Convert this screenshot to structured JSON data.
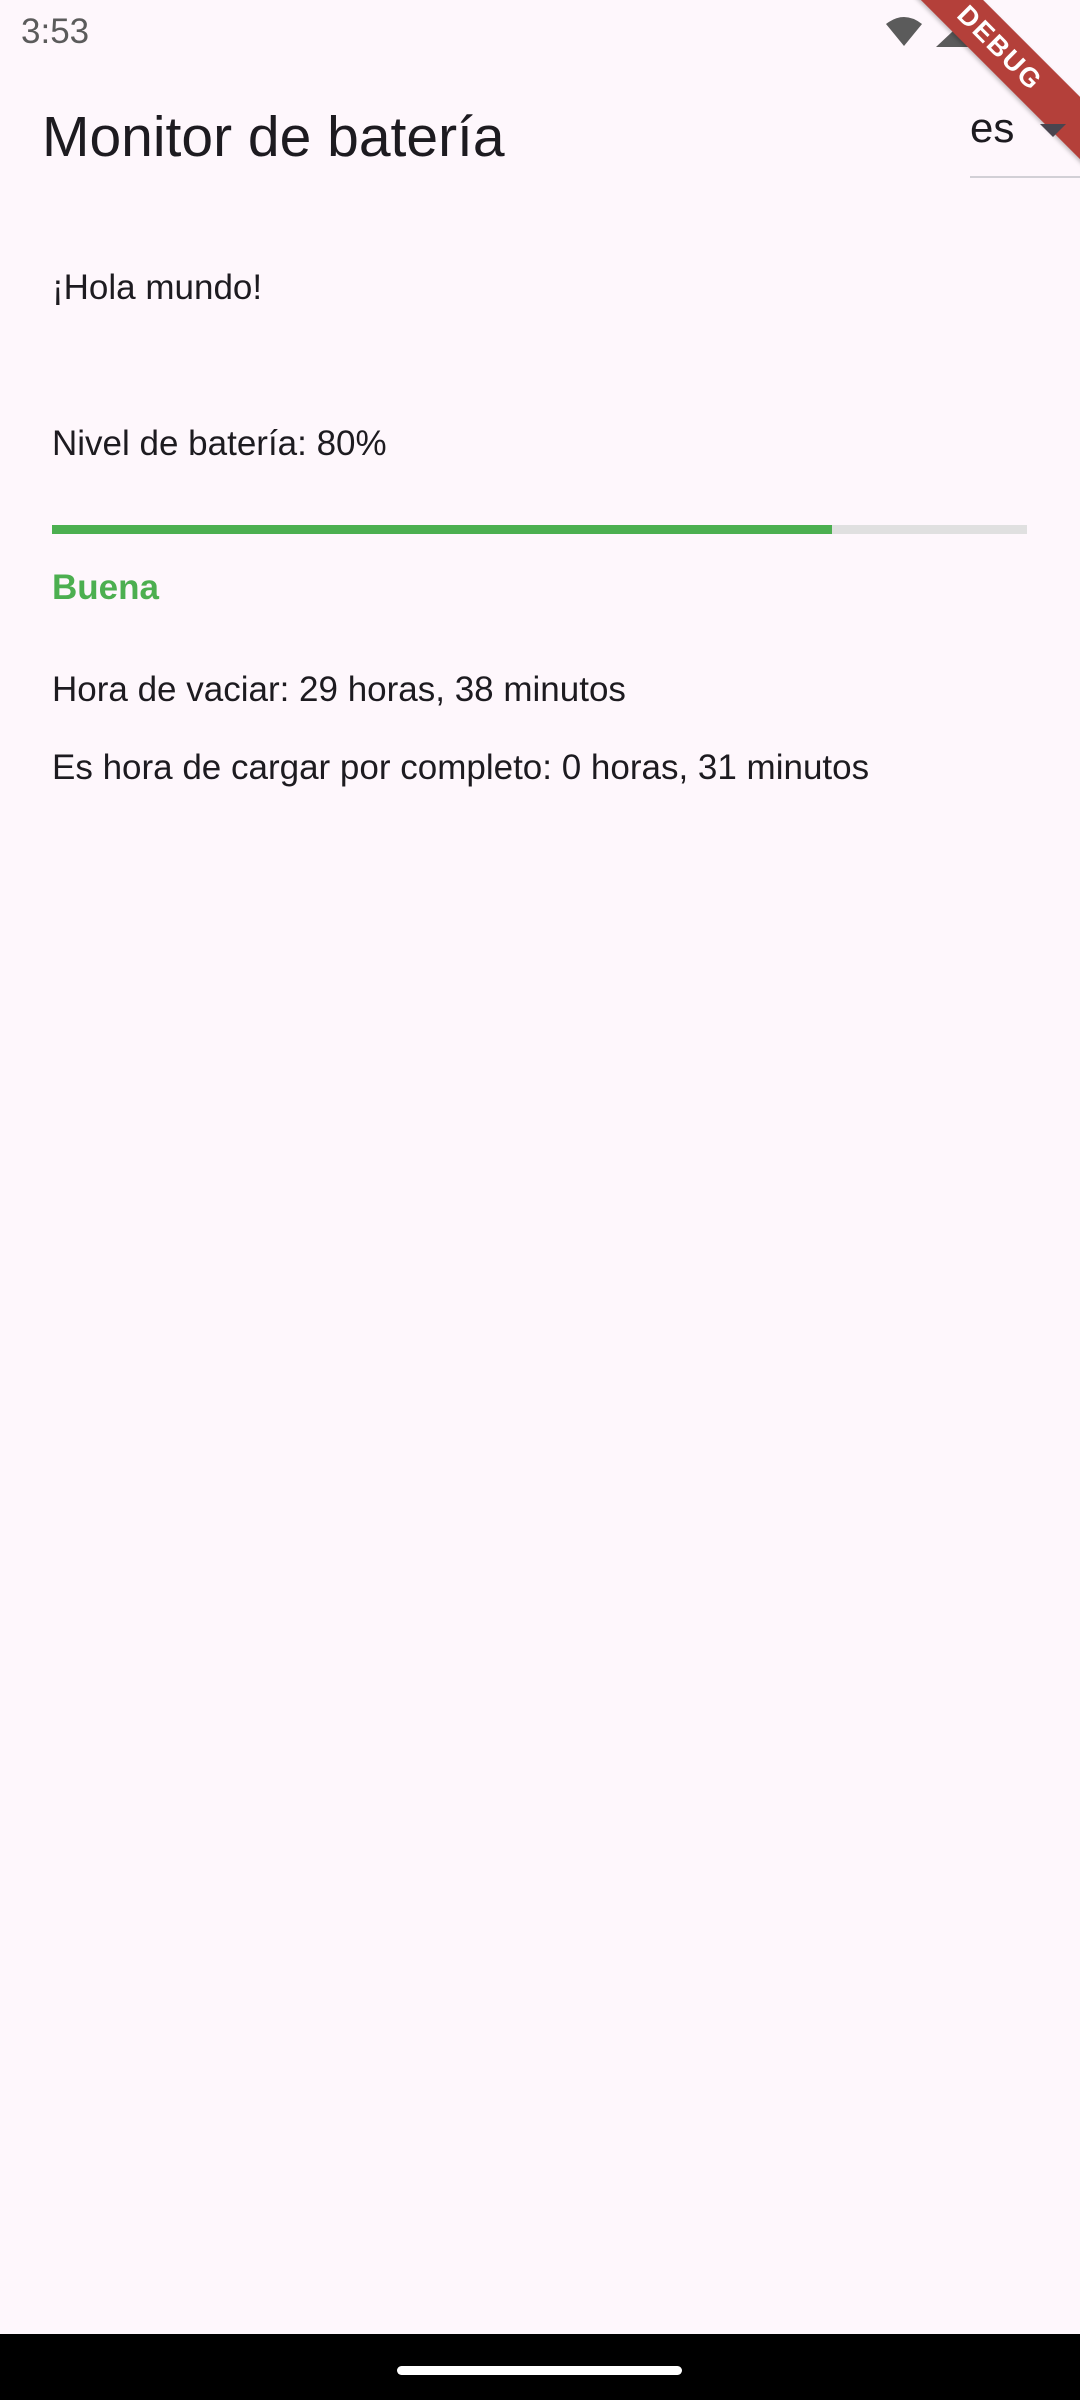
{
  "status_bar": {
    "time": "3:53",
    "icons": [
      "wifi-icon",
      "signal-icon",
      "battery-icon"
    ]
  },
  "debug_banner": "DEBUG",
  "app_bar": {
    "title": "Monitor de batería",
    "language": {
      "selected": "es"
    }
  },
  "body": {
    "greeting": "¡Hola mundo!",
    "battery_level_text": "Nivel de batería: 80%",
    "battery_level_fraction": 0.8,
    "status": "Buena",
    "time_to_discharge": "Hora de vaciar: 29 horas, 38 minutos",
    "time_to_charge": "Es hora de cargar por completo: 0 horas, 31 minutos"
  },
  "colors": {
    "background": "#fef7fc",
    "progress_fill": "#4caf50",
    "progress_track": "#e0e0e0",
    "status_good": "#4caf50",
    "debug_ribbon": "#b4403a"
  }
}
